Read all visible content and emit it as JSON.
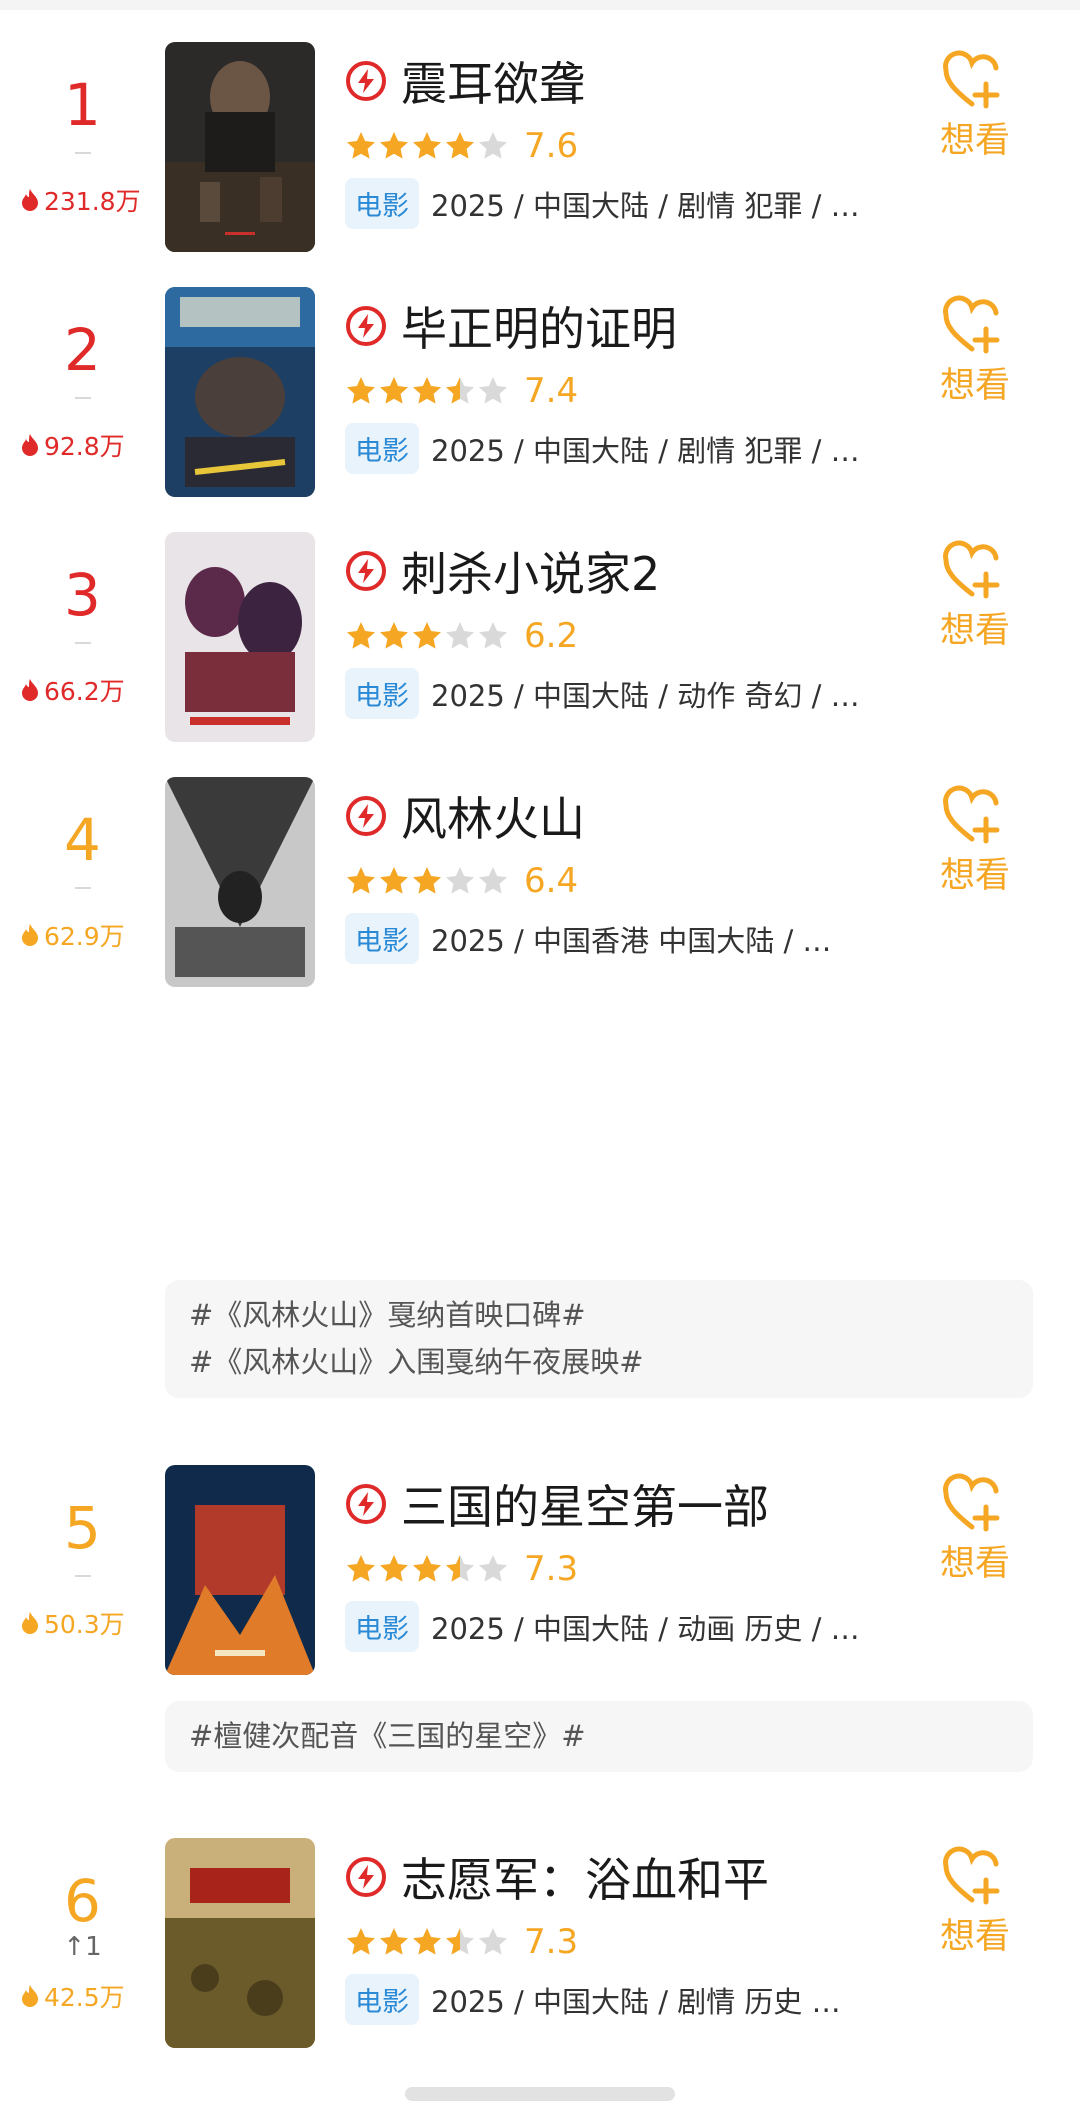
{
  "want_label": "想看",
  "type_tag": "电影",
  "colors": {
    "red": "#e02a2a",
    "orange": "#f5a623",
    "star": "#f5a623",
    "star_empty": "#d9d9d9",
    "tag_bg": "#e8f3fb",
    "tag_text": "#2b8ad6"
  },
  "items": [
    {
      "rank": "1",
      "heat": "231.8万",
      "title": "震耳欲聋",
      "stars": 4,
      "score": "7.6",
      "meta": "2025 / 中国大陆 / 剧情 犯罪 / …",
      "rank_color": "red"
    },
    {
      "rank": "2",
      "heat": "92.8万",
      "title": "毕正明的证明",
      "stars": 3.5,
      "score": "7.4",
      "meta": "2025 / 中国大陆 / 剧情 犯罪 / …",
      "rank_color": "red"
    },
    {
      "rank": "3",
      "heat": "66.2万",
      "title": "刺杀小说家2",
      "stars": 3,
      "score": "6.2",
      "meta": "2025 / 中国大陆 / 动作 奇幻 / …",
      "rank_color": "red"
    },
    {
      "rank": "4",
      "heat": "62.9万",
      "title": "风林火山",
      "stars": 3,
      "score": "6.4",
      "meta": "2025 / 中国香港 中国大陆 / …",
      "rank_color": "orange",
      "topics": [
        "#《风林火山》戛纳首映口碑#",
        "#《风林火山》入围戛纳午夜展映#"
      ]
    },
    {
      "rank": "5",
      "heat": "50.3万",
      "title": "三国的星空第一部",
      "stars": 3.5,
      "score": "7.3",
      "meta": "2025 / 中国大陆 / 动画 历史 / …",
      "rank_color": "orange",
      "topics": [
        "#檀健次配音《三国的星空》#"
      ]
    },
    {
      "rank": "6",
      "rank_change": "↑1",
      "heat": "42.5万",
      "title": "志愿军：浴血和平",
      "stars": 3.5,
      "score": "7.3",
      "meta": "2025 / 中国大陆 / 剧情 历史 …",
      "rank_color": "orange"
    }
  ]
}
